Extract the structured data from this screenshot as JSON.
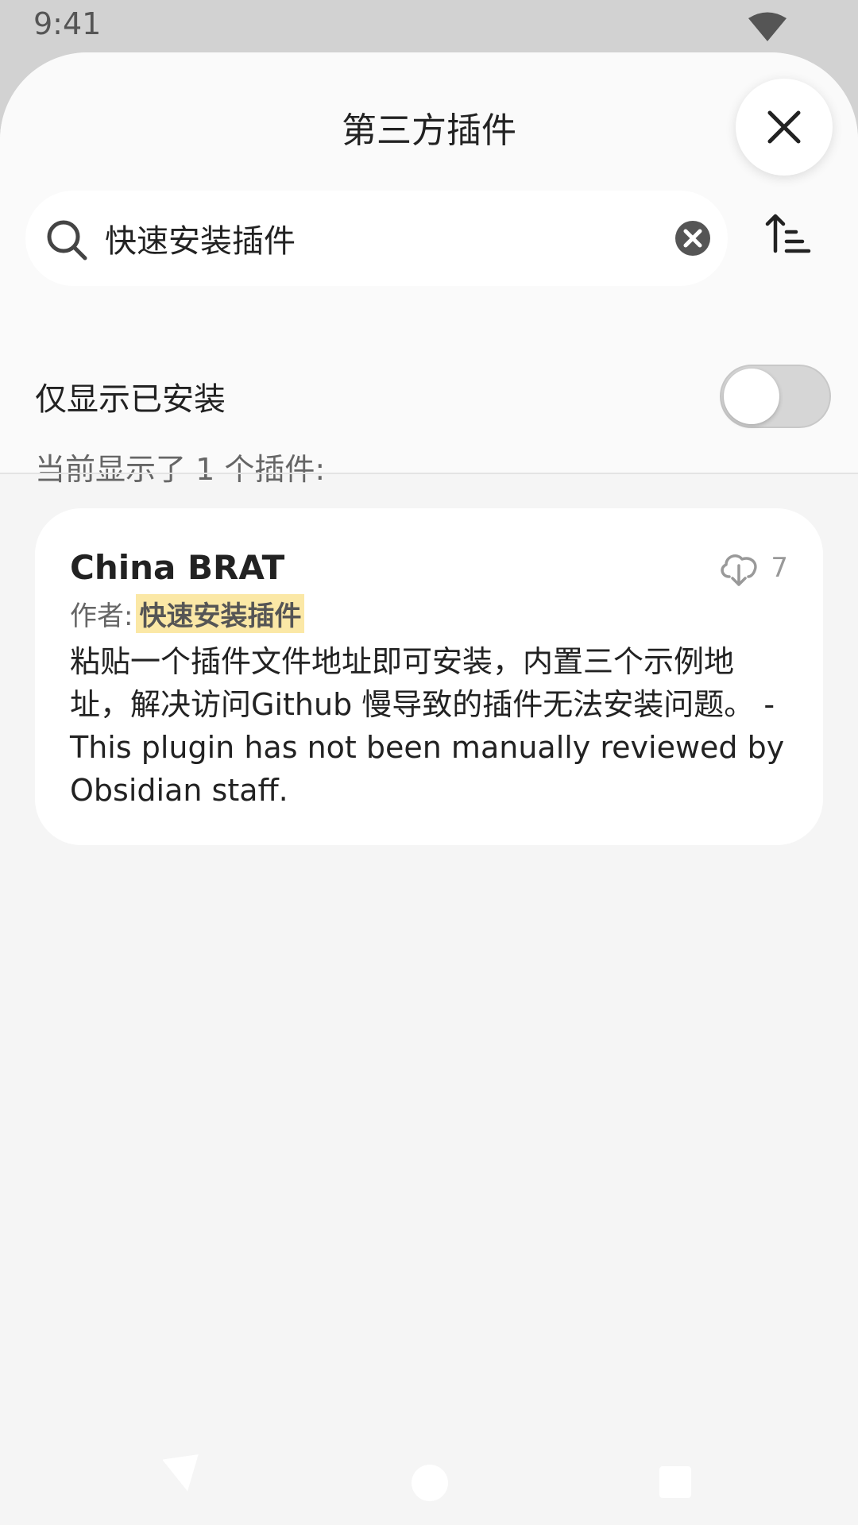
{
  "status_bar": {
    "time": "9:41",
    "wifi_icon": "wifi-icon"
  },
  "header": {
    "title": "第三方插件",
    "close_icon": "close-icon"
  },
  "search": {
    "value": "快速安装插件",
    "placeholder": "",
    "clear_icon": "clear-icon",
    "sort_icon": "sort-ascending-icon"
  },
  "filter": {
    "label": "仅显示已安装",
    "installed_only": false
  },
  "result_count_text": "当前显示了 1 个插件:",
  "plugins": [
    {
      "name": "China BRAT",
      "downloads": "7",
      "author_label": "作者:",
      "author": "快速安装插件",
      "description": "粘贴一个插件文件地址即可安装，内置三个示例地址，解决访问Github 慢导致的插件无法安装问题。 - This plugin has not been manually reviewed by Obsidian staff."
    }
  ],
  "nav_bar": {
    "back_icon": "back-icon",
    "home_icon": "home-icon",
    "recent_icon": "recent-apps-icon"
  }
}
